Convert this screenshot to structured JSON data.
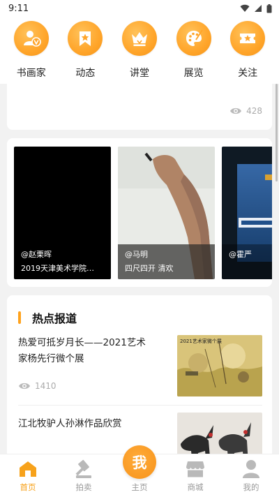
{
  "status_bar": {
    "time": "9:11"
  },
  "categories": [
    {
      "label": "书画家",
      "icon": "artist-icon"
    },
    {
      "label": "动态",
      "icon": "bookmark-star-icon"
    },
    {
      "label": "讲堂",
      "icon": "crown-icon"
    },
    {
      "label": "展览",
      "icon": "palette-icon"
    },
    {
      "label": "关注",
      "icon": "ticket-star-icon"
    }
  ],
  "top_card": {
    "views": "428"
  },
  "videos": [
    {
      "author": "@赵栗晖",
      "title": "2019天津美术学院…"
    },
    {
      "author": "@马明",
      "title": "四尺四开 清欢"
    },
    {
      "author": "@霍严",
      "title": ""
    }
  ],
  "news": {
    "heading": "热点报道",
    "items": [
      {
        "title": "热爱可抵岁月长——2021艺术家杨先行微个展",
        "views": "1410",
        "thumb_caption": "2021艺术家微个展"
      },
      {
        "title": "江北牧驴人孙淋作品欣赏",
        "views": ""
      }
    ]
  },
  "bottom_nav": [
    {
      "label": "首页",
      "active": true
    },
    {
      "label": "拍卖",
      "active": false
    },
    {
      "label": "主页",
      "active": false,
      "center_text": "我"
    },
    {
      "label": "商城",
      "active": false
    },
    {
      "label": "我的",
      "active": false
    }
  ],
  "colors": {
    "accent": "#f7a21b",
    "page_bg": "#f2f2f2"
  }
}
